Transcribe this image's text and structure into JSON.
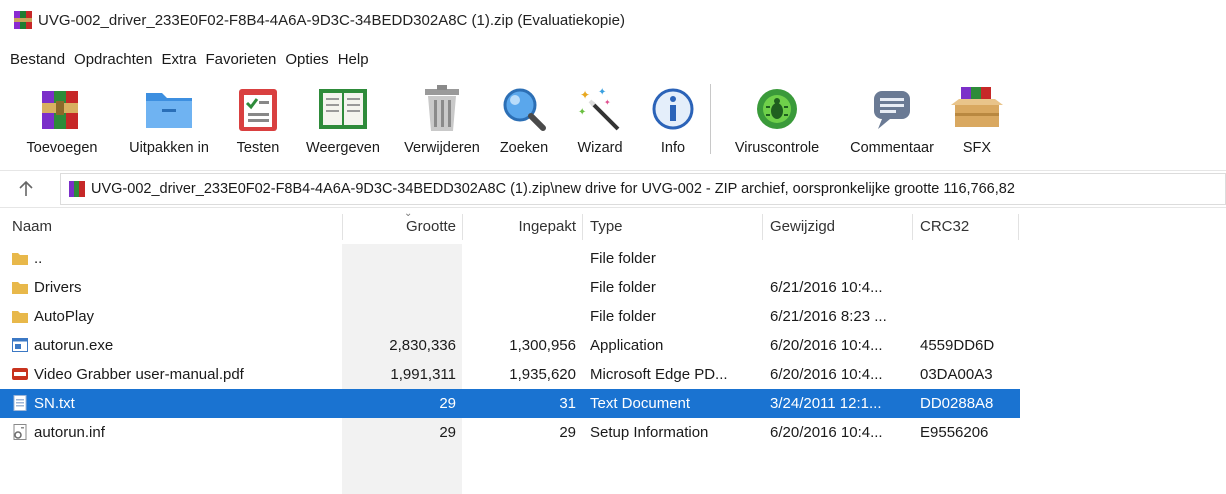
{
  "window": {
    "title": "UVG-002_driver_233E0F02-F8B4-4A6A-9D3C-34BEDD302A8C (1).zip (Evaluatiekopie)",
    "icon": "winrar-books-icon"
  },
  "menu": [
    "Bestand",
    "Opdrachten",
    "Extra",
    "Favorieten",
    "Opties",
    "Help"
  ],
  "toolbar": [
    {
      "label": "Toevoegen",
      "icon": "add-archive-icon"
    },
    {
      "label": "Uitpakken in",
      "icon": "extract-folder-icon"
    },
    {
      "label": "Testen",
      "icon": "test-checklist-icon"
    },
    {
      "label": "Weergeven",
      "icon": "view-book-icon"
    },
    {
      "label": "Verwijderen",
      "icon": "trash-icon"
    },
    {
      "label": "Zoeken",
      "icon": "magnifier-icon"
    },
    {
      "label": "Wizard",
      "icon": "magic-wand-icon"
    },
    {
      "label": "Info",
      "icon": "info-icon"
    },
    {
      "label": "Viruscontrole",
      "icon": "virus-scan-icon"
    },
    {
      "label": "Commentaar",
      "icon": "comment-icon"
    },
    {
      "label": "SFX",
      "icon": "sfx-box-icon"
    }
  ],
  "address": {
    "up_icon": "up-arrow-icon",
    "text": "UVG-002_driver_233E0F02-F8B4-4A6A-9D3C-34BEDD302A8C (1).zip\\new drive for UVG-002 - ZIP archief, oorspronkelijke grootte 116,766,82"
  },
  "columns": {
    "name": "Naam",
    "size": "Grootte",
    "packed": "Ingepakt",
    "type": "Type",
    "modified": "Gewijzigd",
    "crc": "CRC32"
  },
  "files": [
    {
      "name": "..",
      "size": "",
      "packed": "",
      "type": "File folder",
      "modified": "",
      "crc": "",
      "icon": "folder-icon"
    },
    {
      "name": "Drivers",
      "size": "",
      "packed": "",
      "type": "File folder",
      "modified": "6/21/2016 10:4...",
      "crc": "",
      "icon": "folder-icon"
    },
    {
      "name": "AutoPlay",
      "size": "",
      "packed": "",
      "type": "File folder",
      "modified": "6/21/2016 8:23 ...",
      "crc": "",
      "icon": "folder-icon"
    },
    {
      "name": "autorun.exe",
      "size": "2,830,336",
      "packed": "1,300,956",
      "type": "Application",
      "modified": "6/20/2016 10:4...",
      "crc": "4559DD6D",
      "icon": "exe-icon"
    },
    {
      "name": "Video Grabber user-manual.pdf",
      "size": "1,991,311",
      "packed": "1,935,620",
      "type": "Microsoft Edge PD...",
      "modified": "6/20/2016 10:4...",
      "crc": "03DA00A3",
      "icon": "pdf-icon"
    },
    {
      "name": "SN.txt",
      "size": "29",
      "packed": "31",
      "type": "Text Document",
      "modified": "3/24/2011 12:1...",
      "crc": "DD0288A8",
      "icon": "text-file-icon",
      "selected": true
    },
    {
      "name": "autorun.inf",
      "size": "29",
      "packed": "29",
      "type": "Setup Information",
      "modified": "6/20/2016 10:4...",
      "crc": "E9556206",
      "icon": "setup-file-icon"
    }
  ],
  "colors": {
    "selection": "#1a73d1",
    "folder": "#e8b84a"
  }
}
